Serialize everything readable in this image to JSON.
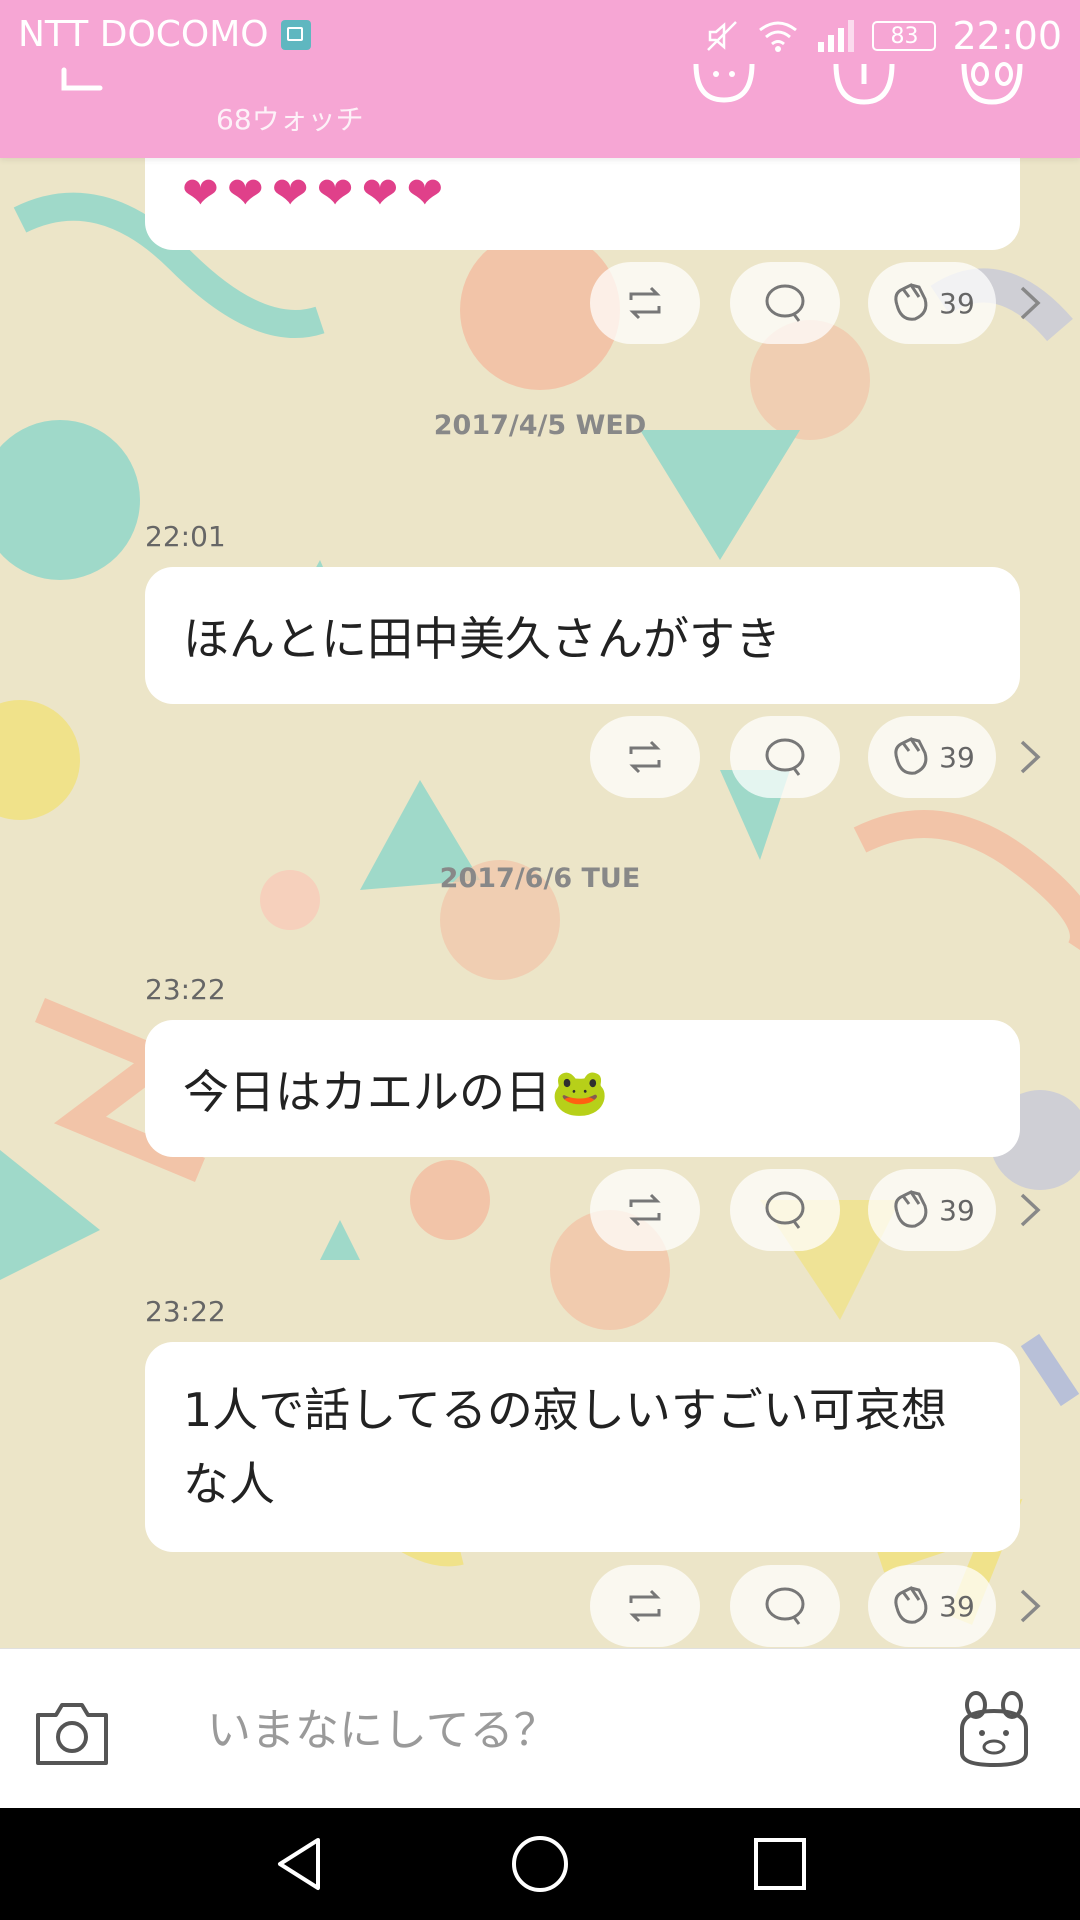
{
  "status_bar": {
    "carrier": "NTT DOCOMO",
    "battery": "83",
    "time": "22:00"
  },
  "header": {
    "subtitle": "68ウォッチ"
  },
  "posts": [
    {
      "kind": "hearts",
      "text": "❤❤❤❤❤❤",
      "clap_count": "39"
    },
    {
      "date": "2017/4/5 WED",
      "time": "22:01",
      "text": "ほんとに田中美久さんがすき",
      "clap_count": "39"
    },
    {
      "date": "2017/6/6 TUE",
      "time": "23:22",
      "text": "今日はカエルの日🐸",
      "clap_count": "39"
    },
    {
      "time": "23:22",
      "text": "1人で話してるの寂しいすごい可哀想な人",
      "clap_count": "39"
    }
  ],
  "composer": {
    "placeholder": "いまなにしてる？"
  },
  "colors": {
    "header_bg": "#f6a6d4",
    "page_bg": "#ece5c8"
  }
}
